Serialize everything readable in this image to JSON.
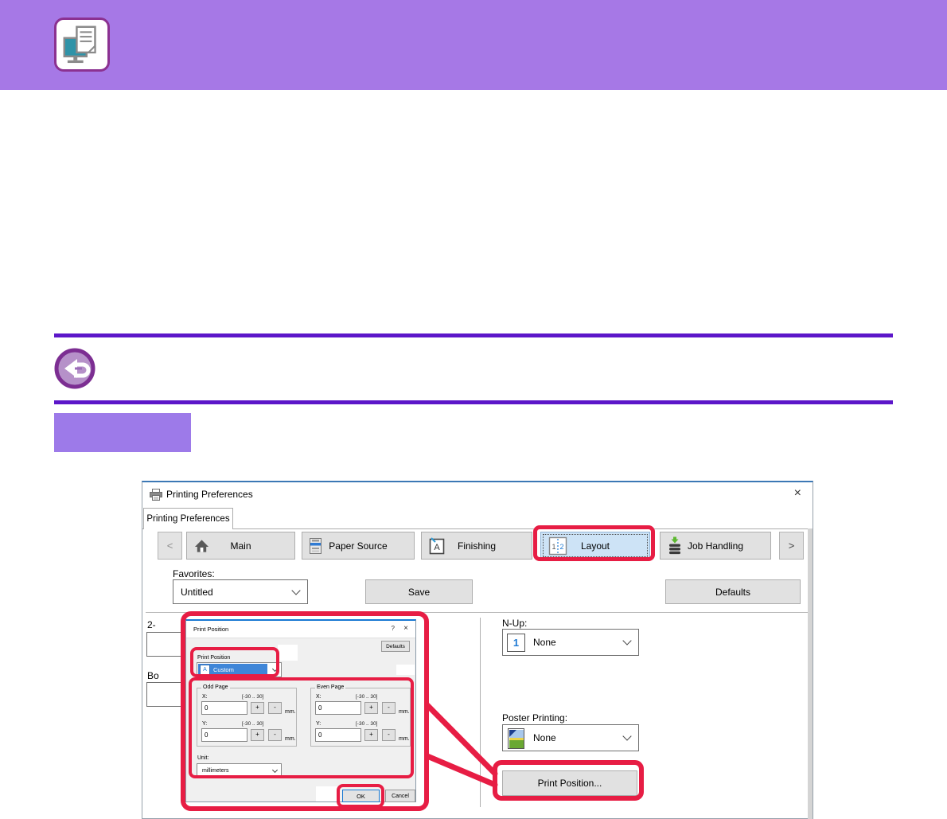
{
  "banner": {
    "icon": "printing-overview-icon"
  },
  "back_button": {
    "icon": "back-arrow-icon"
  },
  "dialog": {
    "title": "Printing Preferences",
    "close_glyph": "×",
    "page_tab": "Printing Preferences",
    "nav_prev": "<",
    "nav_next": ">",
    "tabs": [
      {
        "label": "Main",
        "icon": "home-icon"
      },
      {
        "label": "Paper Source",
        "icon": "copier-icon"
      },
      {
        "label": "Finishing",
        "icon": "finishing-a-icon"
      },
      {
        "label": "Layout",
        "icon": "layout-1-2-icon",
        "selected": true
      },
      {
        "label": "Job Handling",
        "icon": "job-handling-icon"
      }
    ],
    "layout_tab_icon": {
      "left": "1",
      "right": "2"
    },
    "favorites": {
      "label": "Favorites:",
      "value": "Untitled",
      "save_label": "Save",
      "defaults_label": "Defaults"
    },
    "left_column_partial": {
      "two_sided_label": "2-",
      "booklet_label": "Bo"
    },
    "n_up": {
      "label": "N-Up:",
      "value": "None",
      "icon_digit": "1"
    },
    "poster_printing": {
      "label": "Poster Printing:",
      "value": "None"
    },
    "print_position_button_label": "Print Position..."
  },
  "subdialog": {
    "title": "Print Position",
    "help_glyph": "?",
    "close_glyph": "×",
    "defaults_label": "Defaults",
    "print_position": {
      "label": "Print Position",
      "value": "Custom",
      "icon": "custom-position-icon"
    },
    "odd_page": {
      "legend": "Odd Page",
      "x_label": "X:",
      "x_range": "[-30 .. 30]",
      "x_value": "0",
      "y_label": "Y:",
      "y_range": "[-30 .. 30]",
      "y_value": "0",
      "unit": "mm."
    },
    "even_page": {
      "legend": "Even Page",
      "x_label": "X:",
      "x_range": "[-30 .. 30]",
      "x_value": "0",
      "y_label": "Y:",
      "y_range": "[-30 .. 30]",
      "y_value": "0",
      "unit": "mm."
    },
    "spinner": {
      "plus": "+",
      "minus": "-"
    },
    "unit": {
      "label": "Unit:",
      "value": "millimeters"
    },
    "ok_label": "OK",
    "cancel_label": "Cancel"
  },
  "colors": {
    "banner_purple": "#a678e6",
    "rule_purple": "#5c16c9",
    "label_box_purple": "#9d7ae9",
    "annotation_red": "#e71d44",
    "back_icon_ring": "#7c2e92",
    "selected_tab_blue": "#cde3f6",
    "selection_blue": "#3f86d8",
    "monitor_teal": "#2f93a8"
  }
}
